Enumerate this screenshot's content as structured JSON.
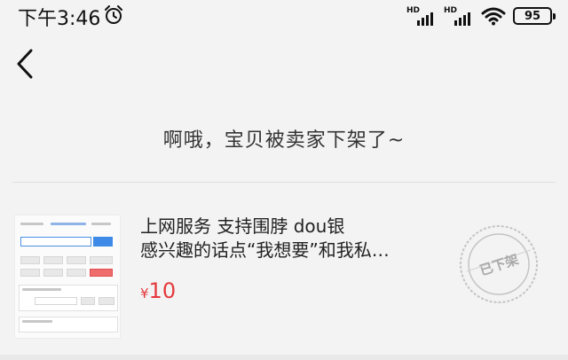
{
  "status_bar": {
    "time": "下午3:46",
    "signal_1_label": "HD",
    "signal_2_label": "HD",
    "battery": "95",
    "icons": [
      "alarm-clock-icon",
      "signal-icon",
      "signal-icon",
      "wifi-icon",
      "battery-icon"
    ]
  },
  "nav": {
    "back_icon": "chevron-left-icon"
  },
  "message": "啊哦，宝贝被卖家下架了~",
  "product": {
    "title_line_1": "上网服务 支持围脖 dou银",
    "title_line_2": "感兴趣的话点“我想要”和我私…",
    "currency": "¥",
    "price": "10",
    "stamp_text": "已下架",
    "price_color": "#e4393c"
  }
}
